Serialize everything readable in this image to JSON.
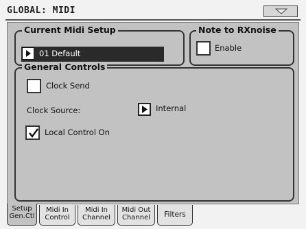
{
  "window": {
    "title": "GLOBAL: MIDI",
    "menu_icon": "triangle-down-icon"
  },
  "current_midi_setup": {
    "legend": "Current Midi Setup",
    "value": "01 Default",
    "arrow_icon": "triangle-right-icon"
  },
  "note_to_rxnoise": {
    "legend": "Note to RXnoise",
    "enable_label": "Enable",
    "enable_checked": false
  },
  "general_controls": {
    "legend": "General Controls",
    "clock_send_label": "Clock Send",
    "clock_send_checked": false,
    "clock_source_label": "Clock Source:",
    "clock_source_value": "Internal",
    "local_control_label": "Local Control On",
    "local_control_checked": true
  },
  "tabs": [
    {
      "line1": "Setup",
      "line2": "Gen.Ctl",
      "active": true
    },
    {
      "line1": "Midi In",
      "line2": "Control",
      "active": false
    },
    {
      "line1": "Midi In",
      "line2": "Channel",
      "active": false
    },
    {
      "line1": "Midi Out",
      "line2": "Channel",
      "active": false
    },
    {
      "line1": "Filters",
      "line2": "",
      "active": false
    }
  ],
  "colors": {
    "panel": "#c2c2c2",
    "field_dark": "#2a2a2a",
    "background": "#f2f2f2"
  }
}
